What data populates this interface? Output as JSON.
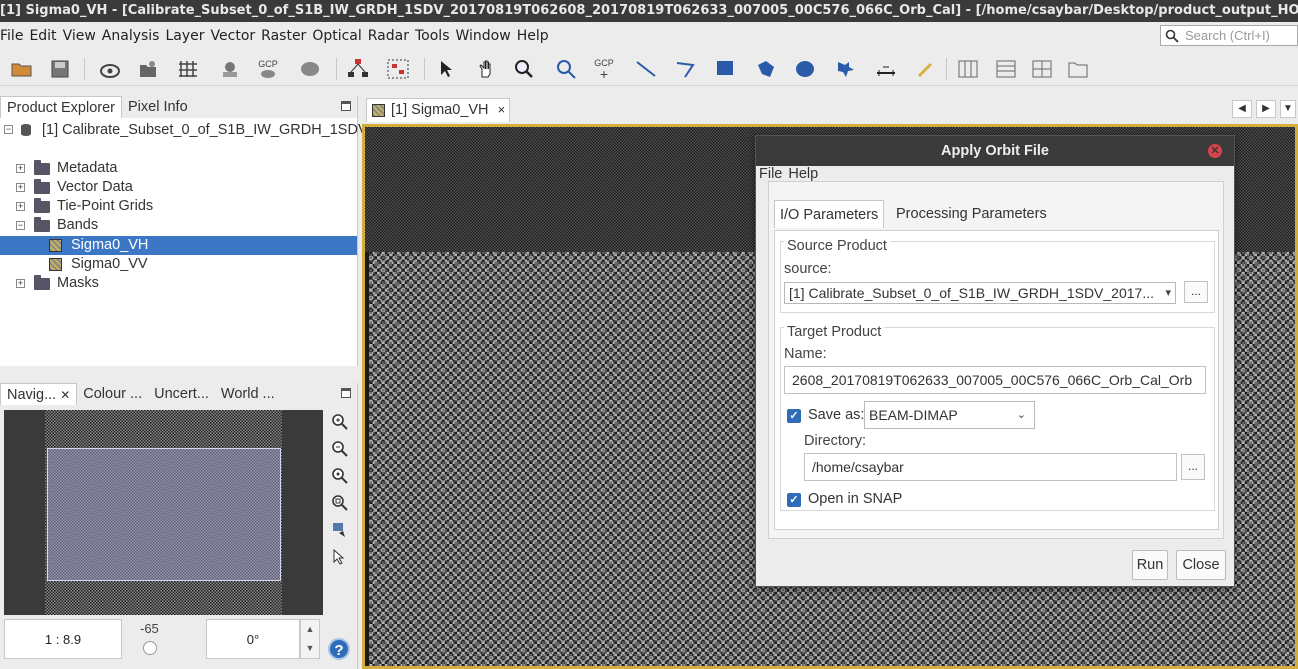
{
  "window": {
    "title": "[1] Sigma0_VH - [Calibrate_Subset_0_of_S1B_IW_GRDH_1SDV_20170819T062608_20170819T062633_007005_00C576_066C_Orb_Cal] - [/home/csaybar/Desktop/product_output_HO..."
  },
  "menubar": {
    "items": [
      "File",
      "Edit",
      "View",
      "Analysis",
      "Layer",
      "Vector",
      "Raster",
      "Optical",
      "Radar",
      "Tools",
      "Window",
      "Help"
    ],
    "search_placeholder": "Search (Ctrl+I)"
  },
  "toolbar": {
    "gcp_label": "GCP"
  },
  "product_explorer": {
    "tabs": [
      "Product Explorer",
      "Pixel Info"
    ],
    "product_label": "[1] Calibrate_Subset_0_of_S1B_IW_GRDH_1SDV",
    "nodes": {
      "metadata": "Metadata",
      "vector_data": "Vector Data",
      "tie_point_grids": "Tie-Point Grids",
      "bands": "Bands",
      "masks": "Masks"
    },
    "bands": [
      "Sigma0_VH",
      "Sigma0_VV"
    ],
    "selected_band": "Sigma0_VH"
  },
  "navigation": {
    "tabs": [
      "Navig...",
      "Colour ...",
      "Uncert...",
      "World ..."
    ],
    "scale": "1 : 8.9",
    "rotation_label": "-65",
    "angle": "0°",
    "help": "?"
  },
  "image_view": {
    "tab_label": "[1] Sigma0_VH",
    "close": "×"
  },
  "dialog": {
    "title": "Apply Orbit File",
    "menu": [
      "File",
      "Help"
    ],
    "tabs": [
      "I/O Parameters",
      "Processing Parameters"
    ],
    "source_product": {
      "group_title": "Source Product",
      "source_label": "source:",
      "source_value": "[1] Calibrate_Subset_0_of_S1B_IW_GRDH_1SDV_2017..."
    },
    "target_product": {
      "group_title": "Target Product",
      "name_label": "Name:",
      "name_value": "2608_20170819T062633_007005_00C576_066C_Orb_Cal_Orb",
      "save_as_label": "Save as:",
      "save_as_checked": true,
      "format": "BEAM-DIMAP",
      "directory_label": "Directory:",
      "directory_value": "/home/csaybar",
      "open_in_snap_label": "Open in SNAP",
      "open_in_snap_checked": true
    },
    "buttons": {
      "run": "Run",
      "close": "Close",
      "browse": "..."
    }
  }
}
